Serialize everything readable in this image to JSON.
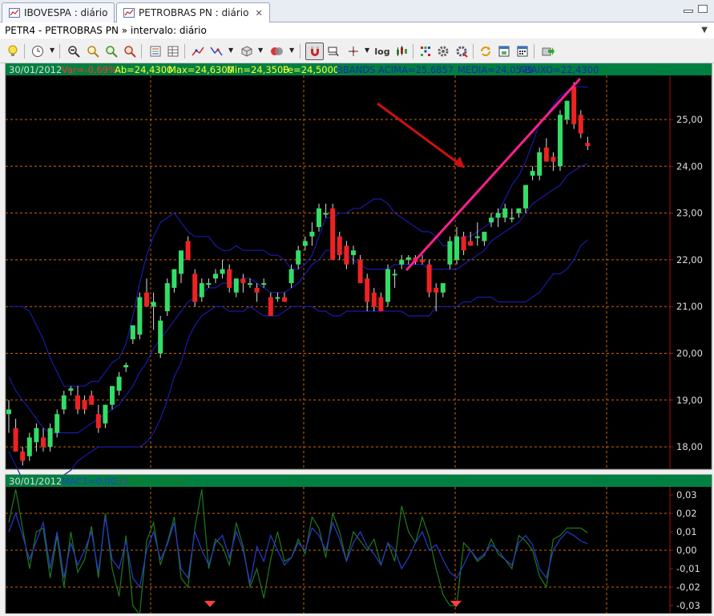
{
  "tabs": [
    {
      "label": "IBOVESPA : diário",
      "active": false
    },
    {
      "label": "PETROBRAS PN : diário",
      "active": true
    }
  ],
  "titlebar": "PETR4 - PETROBRAS PN » intervalo: diário",
  "toolbar_icons": [
    "lightbulb-icon",
    "clock-icon",
    "zoom-fit-icon",
    "zoom-in-icon",
    "zoom-out-icon",
    "zoom-reset-icon",
    "list-icon",
    "table-icon",
    "line-tool-icon",
    "trend-icon",
    "cube-icon",
    "database-icon",
    "magnet-icon",
    "crosshair-icon",
    "cursor-icon",
    "log-icon",
    "candles-icon",
    "grid-icon",
    "gear-icon",
    "settings-icon",
    "refresh-icon",
    "window-icon",
    "calc-icon",
    "export-icon"
  ],
  "price_panel": {
    "info": {
      "date": "30/01/2012",
      "var": "Var=-0,69%",
      "ab": "Ab=24,4300",
      "max": "Max=24,6300",
      "min": "Min=24,3500",
      "fe": "Fe=24,5000",
      "bbands": "BBANDS ACIMA=25,6857",
      "media": "MEDIA=24,0579",
      "abaixo": "ABAIXO=22,4300"
    },
    "y_ticks": [
      "25,00",
      "24,00",
      "23,00",
      "22,00",
      "21,00",
      "20,00",
      "19,00",
      "18,00"
    ]
  },
  "macd_panel": {
    "info": {
      "date": "30/01/2012",
      "mac1": "MAC1=0,0035",
      "mac2": "MAC2=0,0094"
    },
    "y_ticks": [
      "0,03",
      "0,02",
      "0,01",
      "0,00",
      "-0,01",
      "-0,02",
      "-0,03"
    ]
  },
  "colors": {
    "background": "#000000",
    "up_candle": "#33dd66",
    "down_candle": "#ee2222",
    "bands": "#1a1aa8",
    "grid": "#cc6600",
    "info_bar": "#008040",
    "arrow": "#cc1111",
    "trendline": "#ff1f8f",
    "macd1": "#2a3acc",
    "macd2": "#1f7a1f"
  },
  "chart_data": {
    "type": "candlestick",
    "ylim": [
      17.6,
      25.8
    ],
    "candles": [
      {
        "o": 18.7,
        "h": 19.0,
        "l": 18.3,
        "c": 18.8
      },
      {
        "o": 18.4,
        "h": 18.6,
        "l": 17.9,
        "c": 17.9
      },
      {
        "o": 17.9,
        "h": 18.0,
        "l": 17.6,
        "c": 17.7
      },
      {
        "o": 17.8,
        "h": 18.3,
        "l": 17.7,
        "c": 18.2
      },
      {
        "o": 18.1,
        "h": 18.5,
        "l": 17.9,
        "c": 18.4
      },
      {
        "o": 18.2,
        "h": 18.4,
        "l": 17.9,
        "c": 18.0
      },
      {
        "o": 18.0,
        "h": 18.5,
        "l": 17.9,
        "c": 18.4
      },
      {
        "o": 18.3,
        "h": 18.8,
        "l": 18.2,
        "c": 18.7
      },
      {
        "o": 18.8,
        "h": 19.2,
        "l": 18.7,
        "c": 19.1
      },
      {
        "o": 19.2,
        "h": 19.3,
        "l": 19.1,
        "c": 19.25
      },
      {
        "o": 19.1,
        "h": 19.3,
        "l": 18.7,
        "c": 18.8
      },
      {
        "o": 19.0,
        "h": 19.1,
        "l": 18.7,
        "c": 18.8
      },
      {
        "o": 19.1,
        "h": 19.2,
        "l": 18.9,
        "c": 18.9
      },
      {
        "o": 18.7,
        "h": 18.9,
        "l": 18.3,
        "c": 18.4
      },
      {
        "o": 18.5,
        "h": 18.9,
        "l": 18.4,
        "c": 18.9
      },
      {
        "o": 18.9,
        "h": 19.3,
        "l": 18.8,
        "c": 19.3
      },
      {
        "o": 19.2,
        "h": 19.6,
        "l": 19.1,
        "c": 19.5
      },
      {
        "o": 19.7,
        "h": 19.8,
        "l": 19.6,
        "c": 19.75
      },
      {
        "o": 20.3,
        "h": 20.6,
        "l": 20.2,
        "c": 20.6
      },
      {
        "o": 20.4,
        "h": 21.3,
        "l": 20.3,
        "c": 21.2
      },
      {
        "o": 21.3,
        "h": 21.6,
        "l": 21.0,
        "c": 21.0
      },
      {
        "o": 21.0,
        "h": 21.3,
        "l": 20.5,
        "c": 21.1
      },
      {
        "o": 20.0,
        "h": 20.8,
        "l": 19.9,
        "c": 20.7
      },
      {
        "o": 20.9,
        "h": 21.6,
        "l": 20.8,
        "c": 21.5
      },
      {
        "o": 21.4,
        "h": 21.8,
        "l": 21.3,
        "c": 21.8
      },
      {
        "o": 21.7,
        "h": 22.1,
        "l": 21.5,
        "c": 22.2
      },
      {
        "o": 22.4,
        "h": 22.5,
        "l": 22.0,
        "c": 22.0
      },
      {
        "o": 21.7,
        "h": 21.8,
        "l": 21.0,
        "c": 21.1
      },
      {
        "o": 21.2,
        "h": 21.6,
        "l": 21.1,
        "c": 21.5
      },
      {
        "o": 21.5,
        "h": 21.6,
        "l": 21.4,
        "c": 21.5
      },
      {
        "o": 21.6,
        "h": 21.8,
        "l": 21.5,
        "c": 21.7
      },
      {
        "o": 21.7,
        "h": 22.0,
        "l": 21.6,
        "c": 21.8
      },
      {
        "o": 21.8,
        "h": 21.9,
        "l": 21.3,
        "c": 21.4
      },
      {
        "o": 21.3,
        "h": 21.6,
        "l": 21.2,
        "c": 21.6
      },
      {
        "o": 21.6,
        "h": 21.7,
        "l": 21.3,
        "c": 21.5
      },
      {
        "o": 21.5,
        "h": 21.6,
        "l": 21.4,
        "c": 21.5
      },
      {
        "o": 21.4,
        "h": 21.5,
        "l": 21.1,
        "c": 21.3
      },
      {
        "o": 21.5,
        "h": 21.6,
        "l": 21.4,
        "c": 21.5
      },
      {
        "o": 21.2,
        "h": 21.3,
        "l": 20.8,
        "c": 20.8
      },
      {
        "o": 21.2,
        "h": 21.3,
        "l": 21.1,
        "c": 21.2
      },
      {
        "o": 21.2,
        "h": 21.3,
        "l": 21.1,
        "c": 21.1
      },
      {
        "o": 21.5,
        "h": 21.9,
        "l": 21.4,
        "c": 21.8
      },
      {
        "o": 21.9,
        "h": 22.3,
        "l": 21.8,
        "c": 22.2
      },
      {
        "o": 22.3,
        "h": 22.5,
        "l": 22.2,
        "c": 22.4
      },
      {
        "o": 22.5,
        "h": 22.8,
        "l": 22.3,
        "c": 22.6
      },
      {
        "o": 22.7,
        "h": 23.2,
        "l": 22.6,
        "c": 23.1
      },
      {
        "o": 23.0,
        "h": 23.2,
        "l": 22.9,
        "c": 23.0
      },
      {
        "o": 23.1,
        "h": 23.2,
        "l": 22.0,
        "c": 22.0
      },
      {
        "o": 22.5,
        "h": 22.6,
        "l": 22.0,
        "c": 22.1
      },
      {
        "o": 22.3,
        "h": 22.4,
        "l": 21.8,
        "c": 21.9
      },
      {
        "o": 22.1,
        "h": 22.3,
        "l": 21.9,
        "c": 22.2
      },
      {
        "o": 22.0,
        "h": 22.1,
        "l": 21.5,
        "c": 21.5
      },
      {
        "o": 21.6,
        "h": 21.7,
        "l": 20.9,
        "c": 21.1
      },
      {
        "o": 21.3,
        "h": 21.4,
        "l": 20.9,
        "c": 21.0
      },
      {
        "o": 21.2,
        "h": 21.3,
        "l": 20.9,
        "c": 20.9
      },
      {
        "o": 21.1,
        "h": 21.9,
        "l": 21.0,
        "c": 21.8
      },
      {
        "o": 21.7,
        "h": 21.8,
        "l": 21.4,
        "c": 21.7
      },
      {
        "o": 21.9,
        "h": 22.1,
        "l": 21.8,
        "c": 22.0
      },
      {
        "o": 22.0,
        "h": 22.1,
        "l": 21.9,
        "c": 22.05
      },
      {
        "o": 22.05,
        "h": 22.1,
        "l": 21.9,
        "c": 21.95
      },
      {
        "o": 22.0,
        "h": 22.1,
        "l": 21.9,
        "c": 21.95
      },
      {
        "o": 21.9,
        "h": 22.0,
        "l": 21.2,
        "c": 21.3
      },
      {
        "o": 21.4,
        "h": 21.5,
        "l": 20.9,
        "c": 21.3
      },
      {
        "o": 21.3,
        "h": 21.5,
        "l": 21.2,
        "c": 21.5
      },
      {
        "o": 21.9,
        "h": 22.5,
        "l": 21.8,
        "c": 22.4
      },
      {
        "o": 22.0,
        "h": 22.7,
        "l": 21.9,
        "c": 22.5
      },
      {
        "o": 22.5,
        "h": 22.6,
        "l": 22.1,
        "c": 22.2
      },
      {
        "o": 22.4,
        "h": 22.6,
        "l": 22.3,
        "c": 22.3
      },
      {
        "o": 22.5,
        "h": 22.8,
        "l": 22.3,
        "c": 22.5
      },
      {
        "o": 22.4,
        "h": 22.6,
        "l": 22.3,
        "c": 22.6
      },
      {
        "o": 22.8,
        "h": 23.0,
        "l": 22.7,
        "c": 22.9
      },
      {
        "o": 22.9,
        "h": 23.1,
        "l": 22.7,
        "c": 23.0
      },
      {
        "o": 22.9,
        "h": 23.2,
        "l": 22.8,
        "c": 23.1
      },
      {
        "o": 22.9,
        "h": 23.1,
        "l": 22.8,
        "c": 22.9
      },
      {
        "o": 23.0,
        "h": 23.1,
        "l": 22.9,
        "c": 23.1
      },
      {
        "o": 23.1,
        "h": 23.6,
        "l": 23.0,
        "c": 23.6
      },
      {
        "o": 23.8,
        "h": 24.0,
        "l": 23.7,
        "c": 23.9
      },
      {
        "o": 23.8,
        "h": 24.4,
        "l": 23.7,
        "c": 24.3
      },
      {
        "o": 24.4,
        "h": 24.6,
        "l": 24.2,
        "c": 24.1
      },
      {
        "o": 24.2,
        "h": 24.3,
        "l": 23.9,
        "c": 24.1
      },
      {
        "o": 24.0,
        "h": 25.2,
        "l": 23.9,
        "c": 25.1
      },
      {
        "o": 25.0,
        "h": 25.4,
        "l": 24.9,
        "c": 25.4
      },
      {
        "o": 25.7,
        "h": 25.8,
        "l": 24.8,
        "c": 24.9
      },
      {
        "o": 25.1,
        "h": 25.2,
        "l": 24.6,
        "c": 24.7
      },
      {
        "o": 24.5,
        "h": 24.63,
        "l": 24.35,
        "c": 24.43
      }
    ],
    "bb_upper": [
      21.0,
      21.0,
      21.0,
      20.9,
      20.6,
      20.3,
      19.9,
      19.6,
      19.3,
      19.3,
      19.3,
      19.3,
      19.4,
      19.4,
      19.6,
      19.8,
      19.9,
      20.2,
      20.8,
      21.5,
      22.1,
      22.5,
      22.8,
      22.9,
      23.0,
      22.8,
      22.6,
      22.5,
      22.5,
      22.5,
      22.3,
      22.2,
      22.2,
      22.3,
      22.2,
      22.2,
      22.2,
      22.2,
      22.1,
      22.1,
      22.0,
      21.8,
      21.8,
      21.9,
      22.1,
      22.5,
      22.9,
      22.9,
      23.0,
      23.0,
      23.1,
      23.1,
      23.2,
      23.3,
      23.3,
      23.2,
      23.0,
      22.9,
      22.8,
      22.7,
      22.6,
      22.6,
      22.5,
      22.3,
      22.3,
      22.4,
      22.5,
      22.5,
      22.6,
      22.7,
      22.8,
      23.0,
      23.3,
      23.6,
      23.8,
      24.1,
      24.5,
      24.9,
      25.1,
      25.3,
      25.5,
      25.6,
      25.7,
      25.7,
      25.69
    ],
    "bb_middle": [
      19.5,
      19.2,
      19.0,
      18.8,
      18.6,
      18.4,
      18.3,
      18.3,
      18.3,
      18.3,
      18.3,
      18.4,
      18.5,
      18.6,
      18.7,
      18.8,
      18.9,
      19.1,
      19.3,
      19.6,
      19.8,
      20.1,
      20.3,
      20.5,
      20.7,
      20.9,
      21.1,
      21.2,
      21.3,
      21.4,
      21.4,
      21.5,
      21.5,
      21.5,
      21.6,
      21.6,
      21.5,
      21.4,
      21.3,
      21.3,
      21.3,
      21.4,
      21.5,
      21.7,
      21.9,
      22.0,
      22.2,
      22.2,
      22.2,
      22.1,
      22.0,
      21.9,
      21.8,
      21.8,
      21.8,
      21.8,
      21.9,
      21.9,
      21.9,
      21.9,
      21.9,
      21.8,
      21.8,
      21.8,
      21.8,
      21.8,
      21.9,
      22.0,
      22.1,
      22.2,
      22.4,
      22.5,
      22.6,
      22.7,
      22.8,
      23.0,
      23.2,
      23.3,
      23.4,
      23.5,
      23.6,
      23.8,
      23.9,
      24.0,
      24.06
    ],
    "bb_lower": [
      17.9,
      17.6,
      17.3,
      17.2,
      17.2,
      17.3,
      17.3,
      17.3,
      17.4,
      17.5,
      17.7,
      17.8,
      17.9,
      18.0,
      18.0,
      18.0,
      18.0,
      18.0,
      18.0,
      18.0,
      18.1,
      18.3,
      18.6,
      19.0,
      19.5,
      19.8,
      20.3,
      20.6,
      20.8,
      20.9,
      21.0,
      21.0,
      20.9,
      20.9,
      20.9,
      21.0,
      20.9,
      20.8,
      20.8,
      20.8,
      20.9,
      21.0,
      21.0,
      21.0,
      21.0,
      20.9,
      20.9,
      20.8,
      20.8,
      20.9,
      20.9,
      20.9,
      20.9,
      20.9,
      20.9,
      20.9,
      20.9,
      20.9,
      20.8,
      20.8,
      20.8,
      20.8,
      21.0,
      21.0,
      21.0,
      21.0,
      21.1,
      21.1,
      21.2,
      21.2,
      21.2,
      21.1,
      21.1,
      21.1,
      21.1,
      21.1,
      21.2,
      21.3,
      21.5,
      21.7,
      21.7,
      21.8,
      22.0,
      22.3,
      22.43
    ],
    "macd1": [
      0.01,
      0.02,
      0.008,
      -0.005,
      0.005,
      0.015,
      -0.01,
      0.01,
      -0.015,
      0.004,
      -0.008,
      0.0,
      0.01,
      -0.012,
      0.018,
      -0.005,
      -0.01,
      0.005,
      -0.015,
      -0.02,
      0.0,
      0.01,
      -0.005,
      0.003,
      0.015,
      -0.01,
      -0.015,
      0.01,
      0.0,
      -0.008,
      0.004,
      0.008,
      -0.004,
      0.01,
      0.0,
      -0.018,
      0.002,
      -0.006,
      0.008,
      0.0,
      -0.008,
      -0.004,
      0.004,
      0.0,
      0.012,
      0.008,
      0.0,
      0.015,
      0.006,
      -0.006,
      0.004,
      0.01,
      0.002,
      -0.002,
      -0.008,
      0.004,
      0.0,
      -0.01,
      -0.004,
      0.004,
      0.01,
      0.0,
      0.003,
      -0.005,
      -0.012,
      -0.015,
      -0.008,
      0.0,
      -0.005,
      -0.002,
      0.003,
      0.0,
      -0.005,
      -0.008,
      0.004,
      0.008,
      0.003,
      -0.01,
      -0.015,
      0.0,
      0.006,
      0.01,
      0.008,
      0.005,
      0.0035
    ],
    "macd2": [
      0.015,
      0.033,
      0.012,
      -0.01,
      0.01,
      0.012,
      -0.015,
      0.008,
      -0.02,
      0.01,
      -0.012,
      -0.005,
      0.013,
      -0.015,
      0.02,
      -0.01,
      -0.025,
      0.008,
      -0.03,
      -0.035,
      0.005,
      0.015,
      -0.008,
      0.004,
      0.018,
      -0.015,
      -0.02,
      0.012,
      0.033,
      -0.01,
      0.006,
      0.002,
      -0.008,
      0.015,
      0.002,
      -0.02,
      -0.01,
      -0.026,
      -0.005,
      0.01,
      -0.006,
      -0.004,
      0.006,
      -0.002,
      0.018,
      0.012,
      -0.004,
      0.02,
      0.01,
      -0.006,
      0.01,
      0.005,
      0.0,
      0.006,
      -0.008,
      0.004,
      -0.006,
      0.024,
      0.01,
      0.004,
      0.018,
      0.007,
      -0.01,
      -0.024,
      -0.03,
      -0.03,
      0.004,
      0.0,
      -0.006,
      -0.003,
      0.006,
      -0.002,
      -0.005,
      -0.01,
      0.008,
      0.005,
      0.0,
      -0.014,
      -0.02,
      0.006,
      0.008,
      0.012,
      0.012,
      0.012,
      0.0094
    ]
  }
}
